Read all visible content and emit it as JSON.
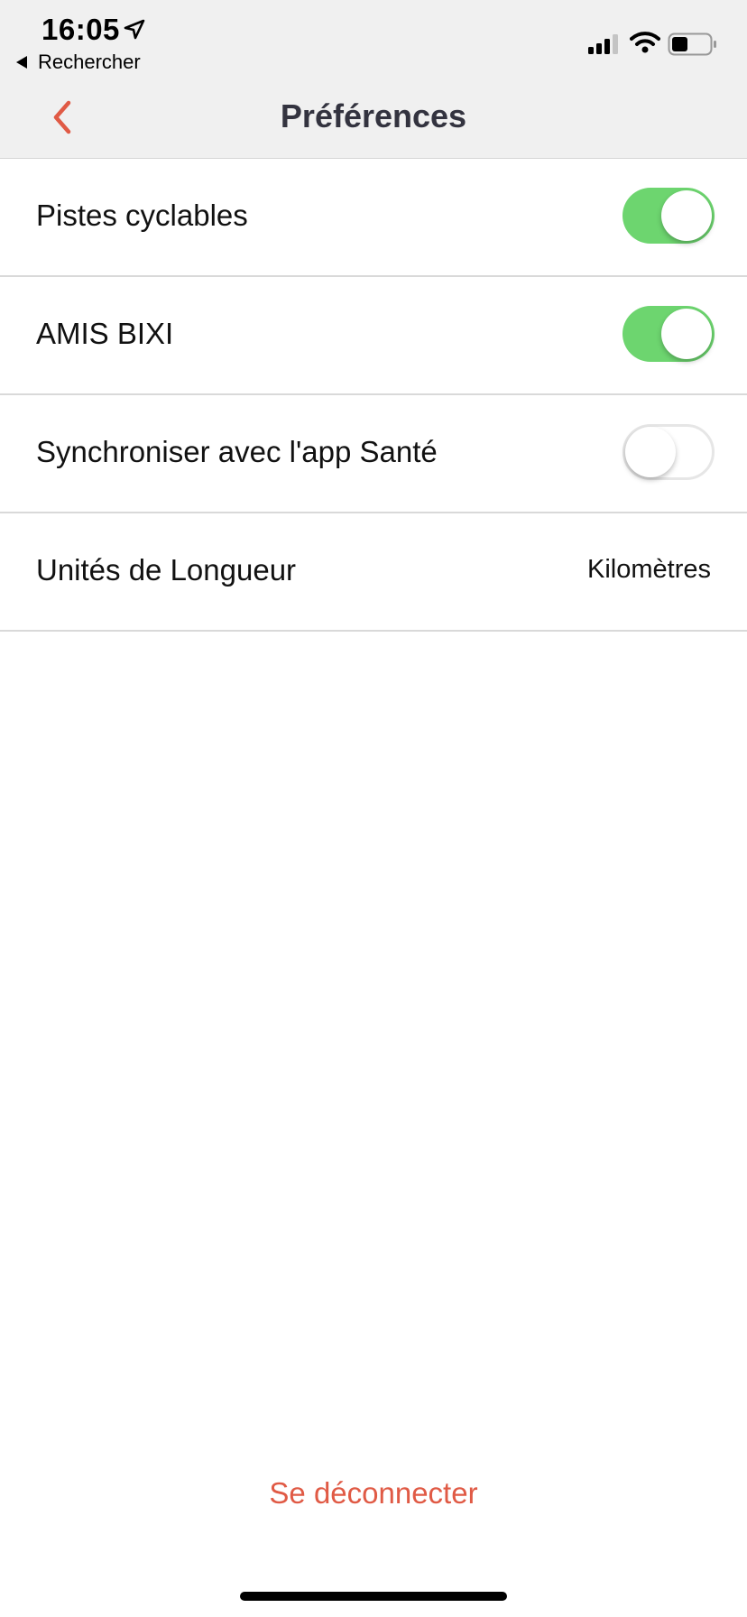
{
  "status_bar": {
    "time": "16:05",
    "back_app_label": "Rechercher",
    "icons": [
      "location-arrow-icon",
      "cellular-signal-icon",
      "wifi-icon",
      "battery-icon"
    ]
  },
  "nav": {
    "title": "Préférences",
    "back_icon": "chevron-left-icon"
  },
  "preferences": [
    {
      "label": "Pistes cyclables",
      "type": "toggle",
      "on": true
    },
    {
      "label": "AMIS BIXI",
      "type": "toggle",
      "on": true
    },
    {
      "label": "Synchroniser avec l'app Santé",
      "type": "toggle",
      "on": false
    },
    {
      "label": "Unités de Longueur",
      "type": "value",
      "value": "Kilomètres"
    }
  ],
  "logout_label": "Se déconnecter",
  "colors": {
    "accent": "#e05a45",
    "toggle_on": "#6dd56f",
    "header_bg": "#f0f0f0",
    "title_text": "#33333f"
  }
}
